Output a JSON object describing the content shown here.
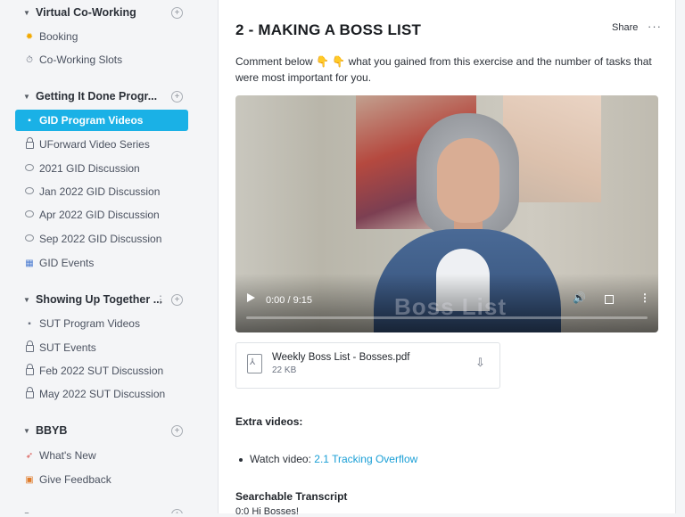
{
  "sidebar": {
    "sections": [
      {
        "title": "Virtual Co-Working",
        "items": [
          {
            "label": "Booking",
            "icon": "sun-icon"
          },
          {
            "label": "Co-Working Slots",
            "icon": "stopwatch-icon"
          }
        ]
      },
      {
        "title": "Getting It Done Progr...",
        "items": [
          {
            "label": "GID Program Videos",
            "icon": "video-camera-icon",
            "active": true
          },
          {
            "label": "UForward Video Series",
            "icon": "lock-icon"
          },
          {
            "label": "2021 GID Discussion",
            "icon": "chat-bubble-icon"
          },
          {
            "label": "Jan 2022 GID Discussion",
            "icon": "chat-bubble-icon"
          },
          {
            "label": "Apr 2022 GID Discussion",
            "icon": "chat-bubble-icon"
          },
          {
            "label": "Sep 2022 GID Discussion",
            "icon": "chat-bubble-icon"
          },
          {
            "label": "GID Events",
            "icon": "calendar-icon"
          }
        ]
      },
      {
        "title": "Showing Up Together ...",
        "items": [
          {
            "label": "SUT Program Videos",
            "icon": "video-camera-icon"
          },
          {
            "label": "SUT Events",
            "icon": "lock-icon"
          },
          {
            "label": "Feb 2022 SUT Discussion",
            "icon": "lock-icon"
          },
          {
            "label": "May 2022 SUT Discussion",
            "icon": "lock-icon"
          }
        ]
      },
      {
        "title": "BBYB",
        "items": [
          {
            "label": "What's New",
            "icon": "rocket-icon"
          },
          {
            "label": "Give Feedback",
            "icon": "gift-icon"
          }
        ]
      }
    ]
  },
  "main": {
    "title": "2 - MAKING A BOSS LIST",
    "share_label": "Share",
    "more_label": "···",
    "intro_text": "Comment below 👇 👇 what you gained from this exercise and the number of tasks that were most important for you.",
    "video": {
      "time_display": "0:00 / 9:15",
      "watermark": "Boss List",
      "progress": 0
    },
    "attachment": {
      "name": "Weekly Boss List - Bosses.pdf",
      "size": "22 KB"
    },
    "extra_heading": "Extra videos:",
    "bullet_prefix": "Watch video: ",
    "bullet_link": "2.1 Tracking Overflow",
    "transcript_heading": "Searchable Transcript",
    "transcript_first_line": "0:0 Hi Bosses!"
  },
  "colors": {
    "accent": "#1ab1e6",
    "link": "#1a9fd6"
  }
}
